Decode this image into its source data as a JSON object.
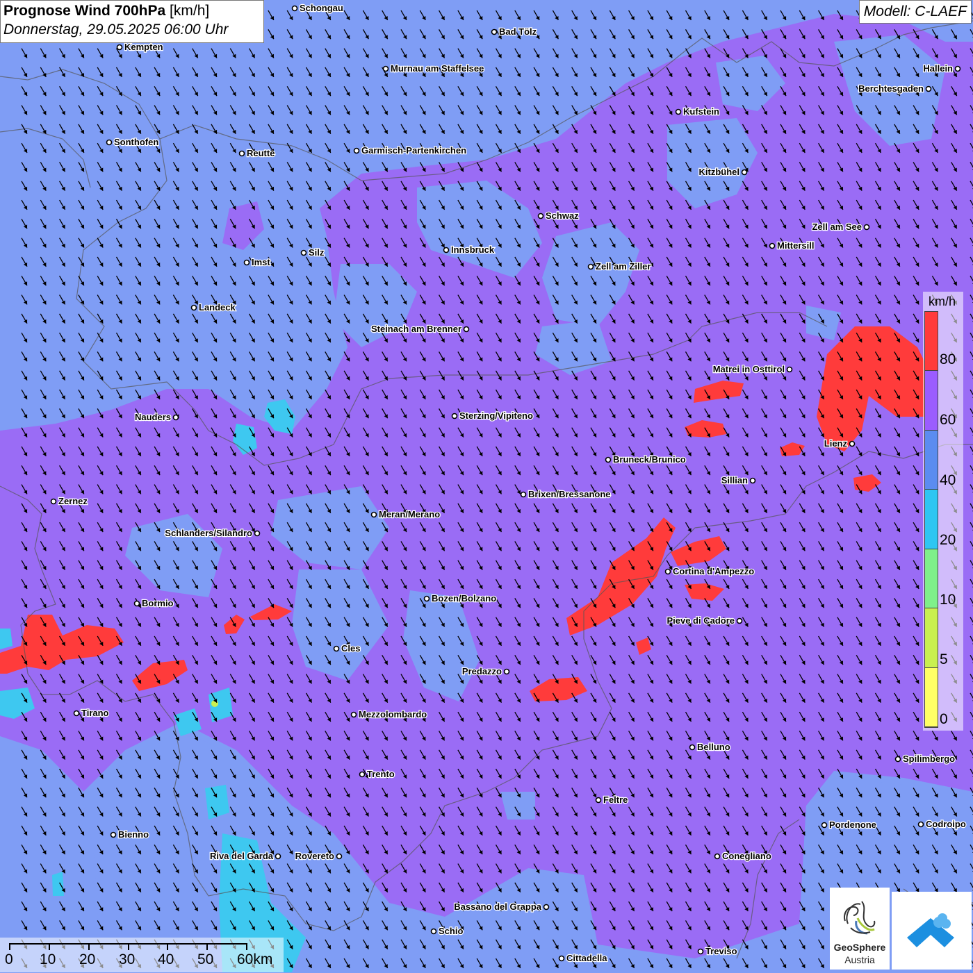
{
  "header": {
    "title_bold": "Prognose Wind 700hPa",
    "title_unit": "[km/h]",
    "datetime": "Donnerstag, 29.05.2025 06:00 Uhr",
    "model": "Modell: C-LAEF"
  },
  "legend": {
    "unit": "km/h",
    "labels": [
      "80",
      "60",
      "40",
      "20",
      "10",
      "5",
      "0"
    ],
    "colors": [
      "#ff3b3b",
      "#9b5cff",
      "#5b8cf0",
      "#2ec6f2",
      "#7ff08a",
      "#c9f050",
      "#ffff66"
    ]
  },
  "scale": {
    "labels": [
      "0",
      "10",
      "20",
      "30",
      "40",
      "50",
      "60km"
    ]
  },
  "logos": {
    "geosphere_line1": "GeoSphere",
    "geosphere_line2": "Austria"
  },
  "places": [
    {
      "name": "Schongau"
    },
    {
      "name": "Bad Tölz"
    },
    {
      "name": "Kempten"
    },
    {
      "name": "Murnau am Staffelsee"
    },
    {
      "name": "Hallein"
    },
    {
      "name": "Berchtesgaden"
    },
    {
      "name": "Kufstein"
    },
    {
      "name": "Sonthofen"
    },
    {
      "name": "Reutte"
    },
    {
      "name": "Garmisch-Partenkirchen"
    },
    {
      "name": "Kitzbühel"
    },
    {
      "name": "Schwaz"
    },
    {
      "name": "Zell am See"
    },
    {
      "name": "Mittersill"
    },
    {
      "name": "Silz"
    },
    {
      "name": "Innsbruck"
    },
    {
      "name": "Imst"
    },
    {
      "name": "Zell am Ziller"
    },
    {
      "name": "Landeck"
    },
    {
      "name": "Steinach am Brenner"
    },
    {
      "name": "Matrei in Osttirol"
    },
    {
      "name": "Nauders"
    },
    {
      "name": "Sterzing/Vipiteno"
    },
    {
      "name": "Lienz"
    },
    {
      "name": "Bruneck/Brunico"
    },
    {
      "name": "Sillian"
    },
    {
      "name": "Zernez"
    },
    {
      "name": "Brixen/Bressanone"
    },
    {
      "name": "Meran/Merano"
    },
    {
      "name": "Schlanders/Silandro"
    },
    {
      "name": "Cortina d'Ampezzo"
    },
    {
      "name": "Bormio"
    },
    {
      "name": "Bozen/Bolzano"
    },
    {
      "name": "Pieve di Cadore"
    },
    {
      "name": "Cles"
    },
    {
      "name": "Predazzo"
    },
    {
      "name": "Tirano"
    },
    {
      "name": "Mezzolombardo"
    },
    {
      "name": "Belluno"
    },
    {
      "name": "Spilimbergo"
    },
    {
      "name": "Trento"
    },
    {
      "name": "Feltre"
    },
    {
      "name": "Bienno"
    },
    {
      "name": "Pordenone"
    },
    {
      "name": "Codroipo"
    },
    {
      "name": "Riva del Garda"
    },
    {
      "name": "Rovereto"
    },
    {
      "name": "Conegliano"
    },
    {
      "name": "Bassano del Grappa"
    },
    {
      "name": "Schio"
    },
    {
      "name": "Treviso"
    },
    {
      "name": "Cittadella"
    }
  ],
  "wind": {
    "direction_deg": 150
  }
}
